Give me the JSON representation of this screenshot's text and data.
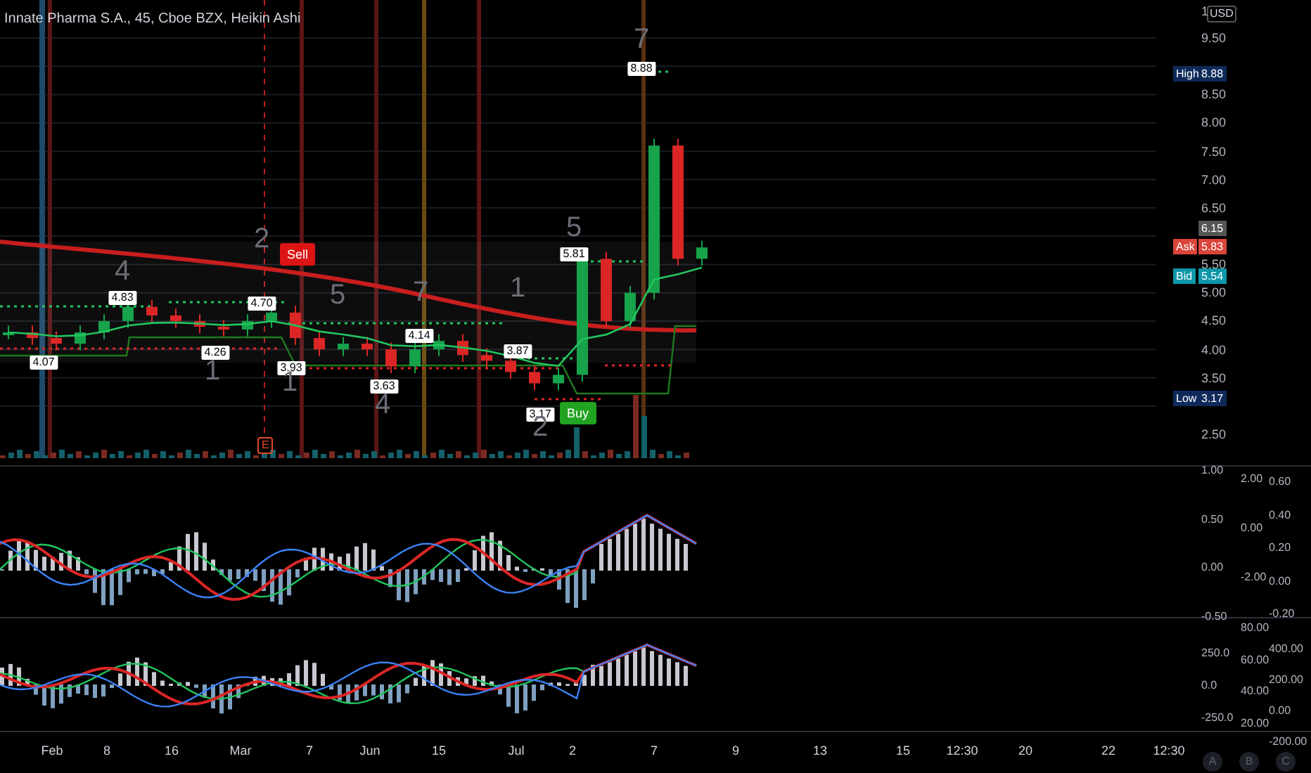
{
  "title": "Innate Pharma S.A., 45, Cboe BZX, Heikin Ashi",
  "price_axis": {
    "currency": "USD",
    "top_label": "1",
    "labels": [
      "9.50",
      "8.50",
      "8.00",
      "7.50",
      "7.00",
      "6.50",
      "5.50",
      "5.00",
      "4.50",
      "4.00",
      "3.50",
      "2.50"
    ]
  },
  "price_tags": [
    {
      "kind": "high",
      "label": "High",
      "value": "8.88"
    },
    {
      "kind": "last",
      "value": "6.15"
    },
    {
      "kind": "ask",
      "label": "Ask",
      "value": "5.83"
    },
    {
      "kind": "bid",
      "label": "Bid",
      "value": "5.54"
    },
    {
      "kind": "low",
      "label": "Low",
      "value": "3.17"
    }
  ],
  "price_labels": [
    "4.07",
    "4.83",
    "4.26",
    "4.70",
    "3.93",
    "3.63",
    "4.14",
    "3.87",
    "3.17",
    "5.81",
    "8.88"
  ],
  "wave_counts": [
    "4",
    "1",
    "2",
    "1",
    "5",
    "4",
    "7",
    "1",
    "2",
    "5",
    "7"
  ],
  "signals": [
    {
      "kind": "sell",
      "label": "Sell"
    },
    {
      "kind": "buy",
      "label": "Buy"
    }
  ],
  "event_marker": "E",
  "oscillator_1": {
    "axis_a": [
      "1.00",
      "0.50",
      "0.00",
      "-0.50"
    ],
    "axis_b": [
      "2.00",
      "0.00",
      "-2.00"
    ],
    "axis_c": [
      "0.60",
      "0.40",
      "0.20",
      "0.00",
      "-0.20"
    ]
  },
  "oscillator_2": {
    "axis_a": [
      "250.0",
      "0.0",
      "-250.0"
    ],
    "axis_b": [
      "80.00",
      "60.00",
      "40.00",
      "20.00"
    ],
    "axis_c": [
      "400.00",
      "200.00",
      "0.00",
      "-200.00"
    ]
  },
  "time_axis": [
    "Feb",
    "8",
    "16",
    "Mar",
    "7",
    "Jun",
    "15",
    "Jul",
    "2",
    "7",
    "9",
    "13",
    "15",
    "12:30",
    "20",
    "22",
    "12:30"
  ],
  "scale_buttons": [
    "A",
    "B",
    "C"
  ]
}
